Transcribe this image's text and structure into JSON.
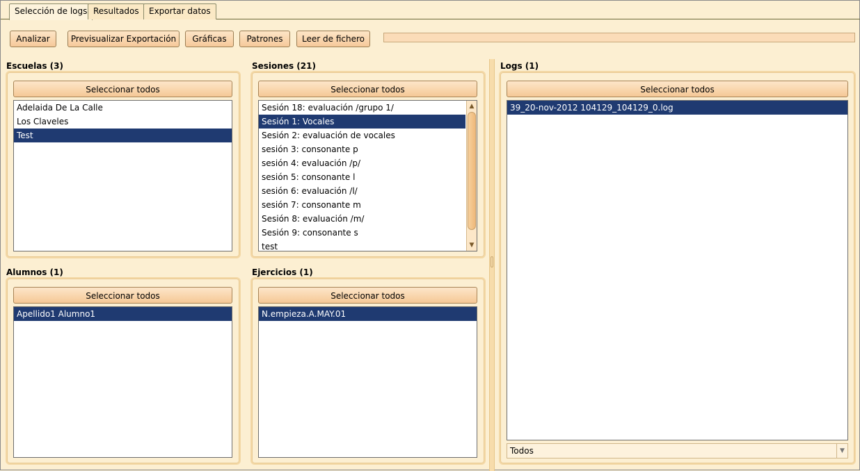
{
  "tabs": [
    {
      "label": "Selección de logs",
      "active": true
    },
    {
      "label": "Resultados",
      "active": false
    },
    {
      "label": "Exportar datos",
      "active": false
    }
  ],
  "toolbar": {
    "analizar": "Analizar",
    "previsualizar": "Previsualizar Exportación",
    "graficas": "Gráficas",
    "patrones": "Patrones",
    "leer_fichero": "Leer de fichero"
  },
  "select_all_label": "Seleccionar todos",
  "escuelas": {
    "title": "Escuelas (3)",
    "items": [
      "Adelaida De La Calle",
      "Los Claveles",
      "Test"
    ],
    "selected_index": 2
  },
  "sesiones": {
    "title": "Sesiones (21)",
    "items": [
      "Sesión 18: evaluación /grupo 1/",
      "Sesión 1: Vocales",
      "Sesión 2: evaluación de vocales",
      "sesión 3: consonante p",
      "sesión 4: evaluación /p/",
      "sesión 5: consonante l",
      "sesión 6: evaluación /l/",
      "sesión 7: consonante m",
      "Sesión 8: evaluación /m/",
      "Sesión 9: consonante s",
      "test"
    ],
    "selected_index": 1
  },
  "alumnos": {
    "title": "Alumnos (1)",
    "items": [
      "Apellido1 Alumno1"
    ],
    "selected_index": 0
  },
  "ejercicios": {
    "title": "Ejercicios (1)",
    "items": [
      "N.empieza.A.MAY.01"
    ],
    "selected_index": 0
  },
  "logs": {
    "title": "Logs (1)",
    "items": [
      "39_20-nov-2012 104129_104129_0.log"
    ],
    "selected_index": 0,
    "filter_value": "Todos"
  },
  "icons": {
    "scroll_up": "▲",
    "scroll_down": "▼",
    "combo_down": "▼"
  },
  "colors": {
    "background": "#fcefd2",
    "selection": "#1f3a71",
    "button_top": "#fde5c6",
    "button_bottom": "#f6c99a"
  }
}
